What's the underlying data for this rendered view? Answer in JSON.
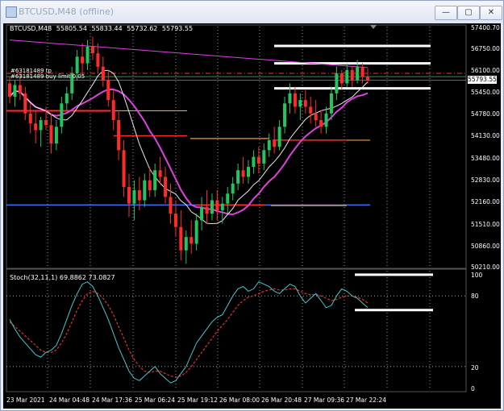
{
  "window": {
    "title": "BTCUSD,M48 (offline)",
    "minimize_glyph": "—",
    "restore_glyph": "▢",
    "close_glyph": "✕"
  },
  "chart_header": {
    "symbol": "BTCUSD,M48",
    "open": "55805.54",
    "high": "55833.44",
    "low": "55732.62",
    "close": "55793.55",
    "order_label_1": "#63181489 tp",
    "order_label_2": "#63181489 buy limit 0.05"
  },
  "price_axis": {
    "ticks": [
      "57400.70",
      "56750.00",
      "56100.00",
      "55450.00",
      "54780.00",
      "54130.00",
      "53480.00",
      "52830.00",
      "52160.00",
      "51510.00",
      "50860.00",
      "50210.00"
    ],
    "current_price": "55793.55"
  },
  "stochastic": {
    "label": "Stoch(32,11,1) 69.8862 73.0827",
    "ticks": [
      "100",
      "80",
      "20",
      "0"
    ]
  },
  "time_axis": {
    "ticks": [
      "23 Mar 2021",
      "24 Mar 04:48",
      "24 Mar 17:36",
      "25 Mar 06:24",
      "25 Mar 19:12",
      "26 Mar 08:00",
      "26 Mar 20:48",
      "27 Mar 09:36",
      "27 Mar 22:24"
    ]
  },
  "colors": {
    "background": "#000000",
    "bull": "#22c55e",
    "bear": "#ff2b2b",
    "ma_slow": "#e040e0",
    "ma_fast": "#e8e8e8",
    "sr_orange": "#f0a030",
    "sr_blue": "#4070ff",
    "stoch_main": "#40c8d0",
    "stoch_signal": "#e03030"
  },
  "chart_data": {
    "type": "candlestick",
    "symbol": "BTCUSD",
    "timeframe": "M48",
    "y_range": [
      50210,
      57400
    ],
    "candles": [
      {
        "o": 55700,
        "h": 55900,
        "l": 55100,
        "c": 55300
      },
      {
        "o": 55300,
        "h": 55800,
        "l": 55000,
        "c": 55650
      },
      {
        "o": 55650,
        "h": 56000,
        "l": 55200,
        "c": 55400
      },
      {
        "o": 55400,
        "h": 55600,
        "l": 54600,
        "c": 54800
      },
      {
        "o": 54800,
        "h": 55100,
        "l": 54200,
        "c": 54500
      },
      {
        "o": 54500,
        "h": 54900,
        "l": 53900,
        "c": 54300
      },
      {
        "o": 54300,
        "h": 54700,
        "l": 53800,
        "c": 54600
      },
      {
        "o": 54600,
        "h": 55000,
        "l": 54300,
        "c": 54450
      },
      {
        "o": 54450,
        "h": 54800,
        "l": 53600,
        "c": 53900
      },
      {
        "o": 53900,
        "h": 54600,
        "l": 53700,
        "c": 54400
      },
      {
        "o": 54400,
        "h": 55300,
        "l": 54200,
        "c": 55100
      },
      {
        "o": 55100,
        "h": 55600,
        "l": 54900,
        "c": 55400
      },
      {
        "o": 55400,
        "h": 56200,
        "l": 55200,
        "c": 56000
      },
      {
        "o": 56000,
        "h": 56700,
        "l": 55800,
        "c": 56500
      },
      {
        "o": 56500,
        "h": 56900,
        "l": 56000,
        "c": 56300
      },
      {
        "o": 56300,
        "h": 57000,
        "l": 56100,
        "c": 56800
      },
      {
        "o": 56800,
        "h": 57100,
        "l": 56400,
        "c": 56600
      },
      {
        "o": 56600,
        "h": 56900,
        "l": 56000,
        "c": 56200
      },
      {
        "o": 56200,
        "h": 56500,
        "l": 55600,
        "c": 55800
      },
      {
        "o": 55800,
        "h": 56100,
        "l": 55000,
        "c": 55200
      },
      {
        "o": 55200,
        "h": 55500,
        "l": 54300,
        "c": 54600
      },
      {
        "o": 54600,
        "h": 54900,
        "l": 53400,
        "c": 53700
      },
      {
        "o": 53700,
        "h": 54000,
        "l": 52300,
        "c": 52600
      },
      {
        "o": 52600,
        "h": 53000,
        "l": 51700,
        "c": 52100
      },
      {
        "o": 52100,
        "h": 52800,
        "l": 51600,
        "c": 52500
      },
      {
        "o": 52500,
        "h": 52900,
        "l": 51900,
        "c": 52200
      },
      {
        "o": 52200,
        "h": 53000,
        "l": 52000,
        "c": 52800
      },
      {
        "o": 52800,
        "h": 53200,
        "l": 52300,
        "c": 52500
      },
      {
        "o": 52500,
        "h": 53300,
        "l": 52300,
        "c": 53100
      },
      {
        "o": 53100,
        "h": 53500,
        "l": 52700,
        "c": 52900
      },
      {
        "o": 52900,
        "h": 53200,
        "l": 52100,
        "c": 52300
      },
      {
        "o": 52300,
        "h": 52700,
        "l": 51500,
        "c": 51800
      },
      {
        "o": 51800,
        "h": 52200,
        "l": 51100,
        "c": 51400
      },
      {
        "o": 51400,
        "h": 51900,
        "l": 50400,
        "c": 50700
      },
      {
        "o": 50700,
        "h": 51300,
        "l": 50300,
        "c": 51100
      },
      {
        "o": 51100,
        "h": 51600,
        "l": 50600,
        "c": 50900
      },
      {
        "o": 50900,
        "h": 51800,
        "l": 50700,
        "c": 51600
      },
      {
        "o": 51600,
        "h": 52300,
        "l": 51300,
        "c": 52000
      },
      {
        "o": 52000,
        "h": 52500,
        "l": 51500,
        "c": 51800
      },
      {
        "o": 51800,
        "h": 52400,
        "l": 51600,
        "c": 52200
      },
      {
        "o": 52200,
        "h": 52500,
        "l": 51600,
        "c": 51900
      },
      {
        "o": 51900,
        "h": 52300,
        "l": 51500,
        "c": 52100
      },
      {
        "o": 52100,
        "h": 52600,
        "l": 51800,
        "c": 52400
      },
      {
        "o": 52400,
        "h": 52900,
        "l": 52200,
        "c": 52700
      },
      {
        "o": 52700,
        "h": 53300,
        "l": 52500,
        "c": 53100
      },
      {
        "o": 53100,
        "h": 53500,
        "l": 52700,
        "c": 52900
      },
      {
        "o": 52900,
        "h": 53400,
        "l": 52700,
        "c": 53200
      },
      {
        "o": 53200,
        "h": 53700,
        "l": 53000,
        "c": 53500
      },
      {
        "o": 53500,
        "h": 53800,
        "l": 53000,
        "c": 53300
      },
      {
        "o": 53300,
        "h": 53900,
        "l": 53100,
        "c": 53700
      },
      {
        "o": 53700,
        "h": 54200,
        "l": 53500,
        "c": 54000
      },
      {
        "o": 54000,
        "h": 54400,
        "l": 53600,
        "c": 53800
      },
      {
        "o": 53800,
        "h": 54600,
        "l": 53700,
        "c": 54400
      },
      {
        "o": 54400,
        "h": 55300,
        "l": 54200,
        "c": 55100
      },
      {
        "o": 55100,
        "h": 55700,
        "l": 54800,
        "c": 55400
      },
      {
        "o": 55400,
        "h": 55600,
        "l": 54800,
        "c": 55000
      },
      {
        "o": 55000,
        "h": 55400,
        "l": 54600,
        "c": 55200
      },
      {
        "o": 55200,
        "h": 55500,
        "l": 54800,
        "c": 55000
      },
      {
        "o": 55000,
        "h": 55300,
        "l": 54500,
        "c": 54800
      },
      {
        "o": 54800,
        "h": 55200,
        "l": 54400,
        "c": 54600
      },
      {
        "o": 54600,
        "h": 54900,
        "l": 54200,
        "c": 54400
      },
      {
        "o": 54400,
        "h": 55000,
        "l": 54200,
        "c": 54800
      },
      {
        "o": 54800,
        "h": 55600,
        "l": 54600,
        "c": 55400
      },
      {
        "o": 55400,
        "h": 56200,
        "l": 55200,
        "c": 56000
      },
      {
        "o": 56000,
        "h": 56100,
        "l": 55500,
        "c": 55700
      },
      {
        "o": 55700,
        "h": 56300,
        "l": 55600,
        "c": 56100
      },
      {
        "o": 56100,
        "h": 56200,
        "l": 55600,
        "c": 55800
      },
      {
        "o": 55800,
        "h": 56400,
        "l": 55700,
        "c": 56200
      },
      {
        "o": 56200,
        "h": 56300,
        "l": 55700,
        "c": 55900
      },
      {
        "o": 55900,
        "h": 56150,
        "l": 55700,
        "c": 55793
      }
    ],
    "stoch_main": [
      60,
      52,
      45,
      40,
      35,
      30,
      28,
      32,
      34,
      38,
      48,
      60,
      72,
      82,
      90,
      92,
      88,
      80,
      70,
      60,
      48,
      36,
      26,
      16,
      10,
      8,
      12,
      16,
      20,
      14,
      10,
      6,
      8,
      14,
      20,
      30,
      40,
      46,
      52,
      58,
      62,
      64,
      72,
      80,
      86,
      88,
      84,
      86,
      92,
      90,
      88,
      84,
      82,
      86,
      90,
      88,
      80,
      74,
      78,
      82,
      76,
      70,
      72,
      80,
      86,
      84,
      80,
      78,
      74,
      70
    ],
    "stoch_signal": [
      58,
      54,
      50,
      46,
      42,
      38,
      34,
      32,
      32,
      34,
      40,
      48,
      58,
      68,
      76,
      82,
      84,
      82,
      78,
      72,
      64,
      54,
      44,
      34,
      26,
      20,
      16,
      15,
      16,
      16,
      14,
      12,
      11,
      12,
      15,
      20,
      26,
      32,
      38,
      44,
      50,
      55,
      60,
      66,
      72,
      76,
      79,
      80,
      82,
      84,
      85,
      86,
      85,
      85,
      86,
      86,
      84,
      82,
      81,
      81,
      80,
      78,
      76,
      77,
      79,
      80,
      80,
      79,
      77,
      74
    ]
  }
}
